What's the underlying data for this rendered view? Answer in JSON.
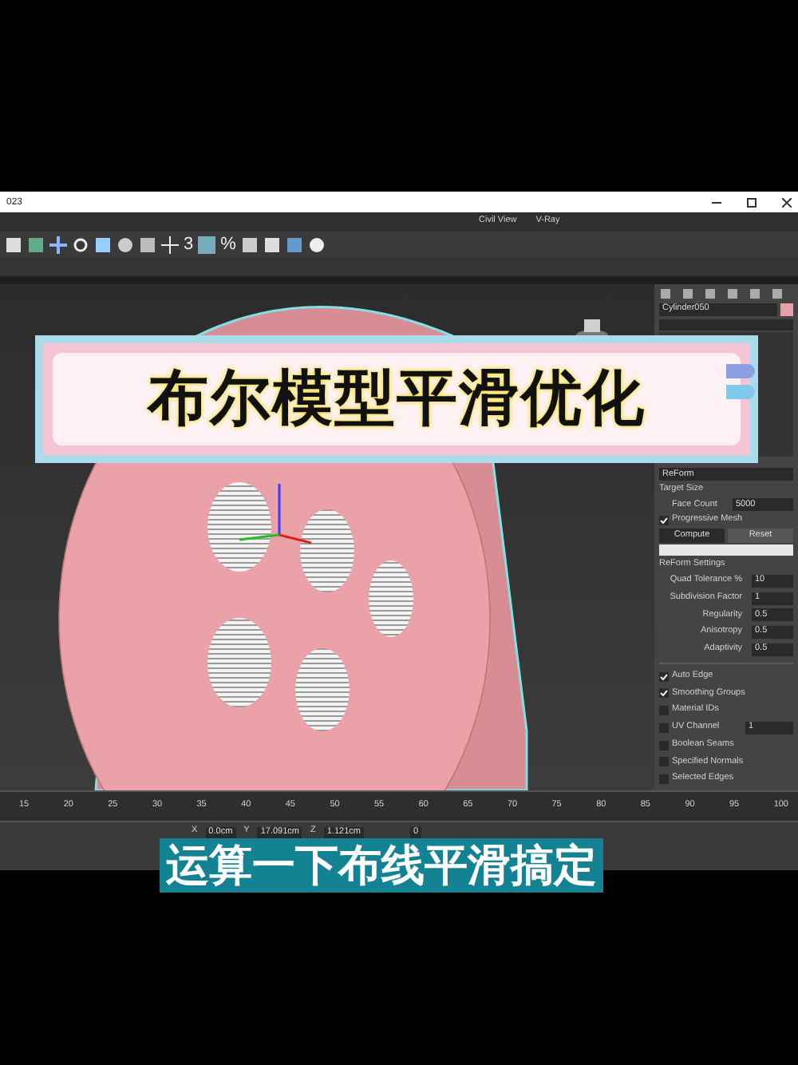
{
  "title_bar": {
    "title": "023"
  },
  "menu": [
    "Civil View",
    "V-Ray"
  ],
  "toolbar": {
    "snap_glyph": "3",
    "percent_glyph": "%"
  },
  "command_panel": {
    "object_name": "Cylinder050",
    "modifier": "ReForm",
    "target_size_label": "Target Size",
    "face_count": {
      "label": "Face Count",
      "value": "5000"
    },
    "progressive_mesh": {
      "label": "Progressive Mesh",
      "checked": true
    },
    "buttons": [
      "Compute",
      "Reset"
    ],
    "settings_title": "ReForm Settings",
    "spinners": [
      {
        "label": "Quad Tolerance %",
        "value": "10"
      },
      {
        "label": "Subdivision Factor",
        "value": "1"
      },
      {
        "label": "Regularity",
        "value": "0.5"
      },
      {
        "label": "Anisotropy",
        "value": "0.5"
      },
      {
        "label": "Adaptivity",
        "value": "0.5"
      }
    ],
    "options": [
      {
        "label": "Auto Edge",
        "checked": true
      },
      {
        "label": "Smoothing Groups",
        "checked": true
      },
      {
        "label": "Material IDs",
        "checked": false
      },
      {
        "label": "UV Channel",
        "checked": false,
        "value": "1"
      },
      {
        "label": "Boolean Seams",
        "checked": false
      },
      {
        "label": "Specified Normals",
        "checked": false
      },
      {
        "label": "Selected Edges",
        "checked": false
      }
    ]
  },
  "timeline": {
    "ticks": [
      "15",
      "20",
      "25",
      "30",
      "35",
      "40",
      "45",
      "50",
      "55",
      "60",
      "65",
      "70",
      "75",
      "80",
      "85",
      "90",
      "95",
      "100"
    ]
  },
  "status_bar": {
    "coords": [
      {
        "axis": "X",
        "value": "0.0cm"
      },
      {
        "axis": "Y",
        "value": "17.091cm"
      },
      {
        "axis": "Z",
        "value": "1.121cm"
      }
    ],
    "frame": "0"
  },
  "title_banner": "布尔模型平滑优化",
  "subtitle": "运算一下布线平滑搞定"
}
